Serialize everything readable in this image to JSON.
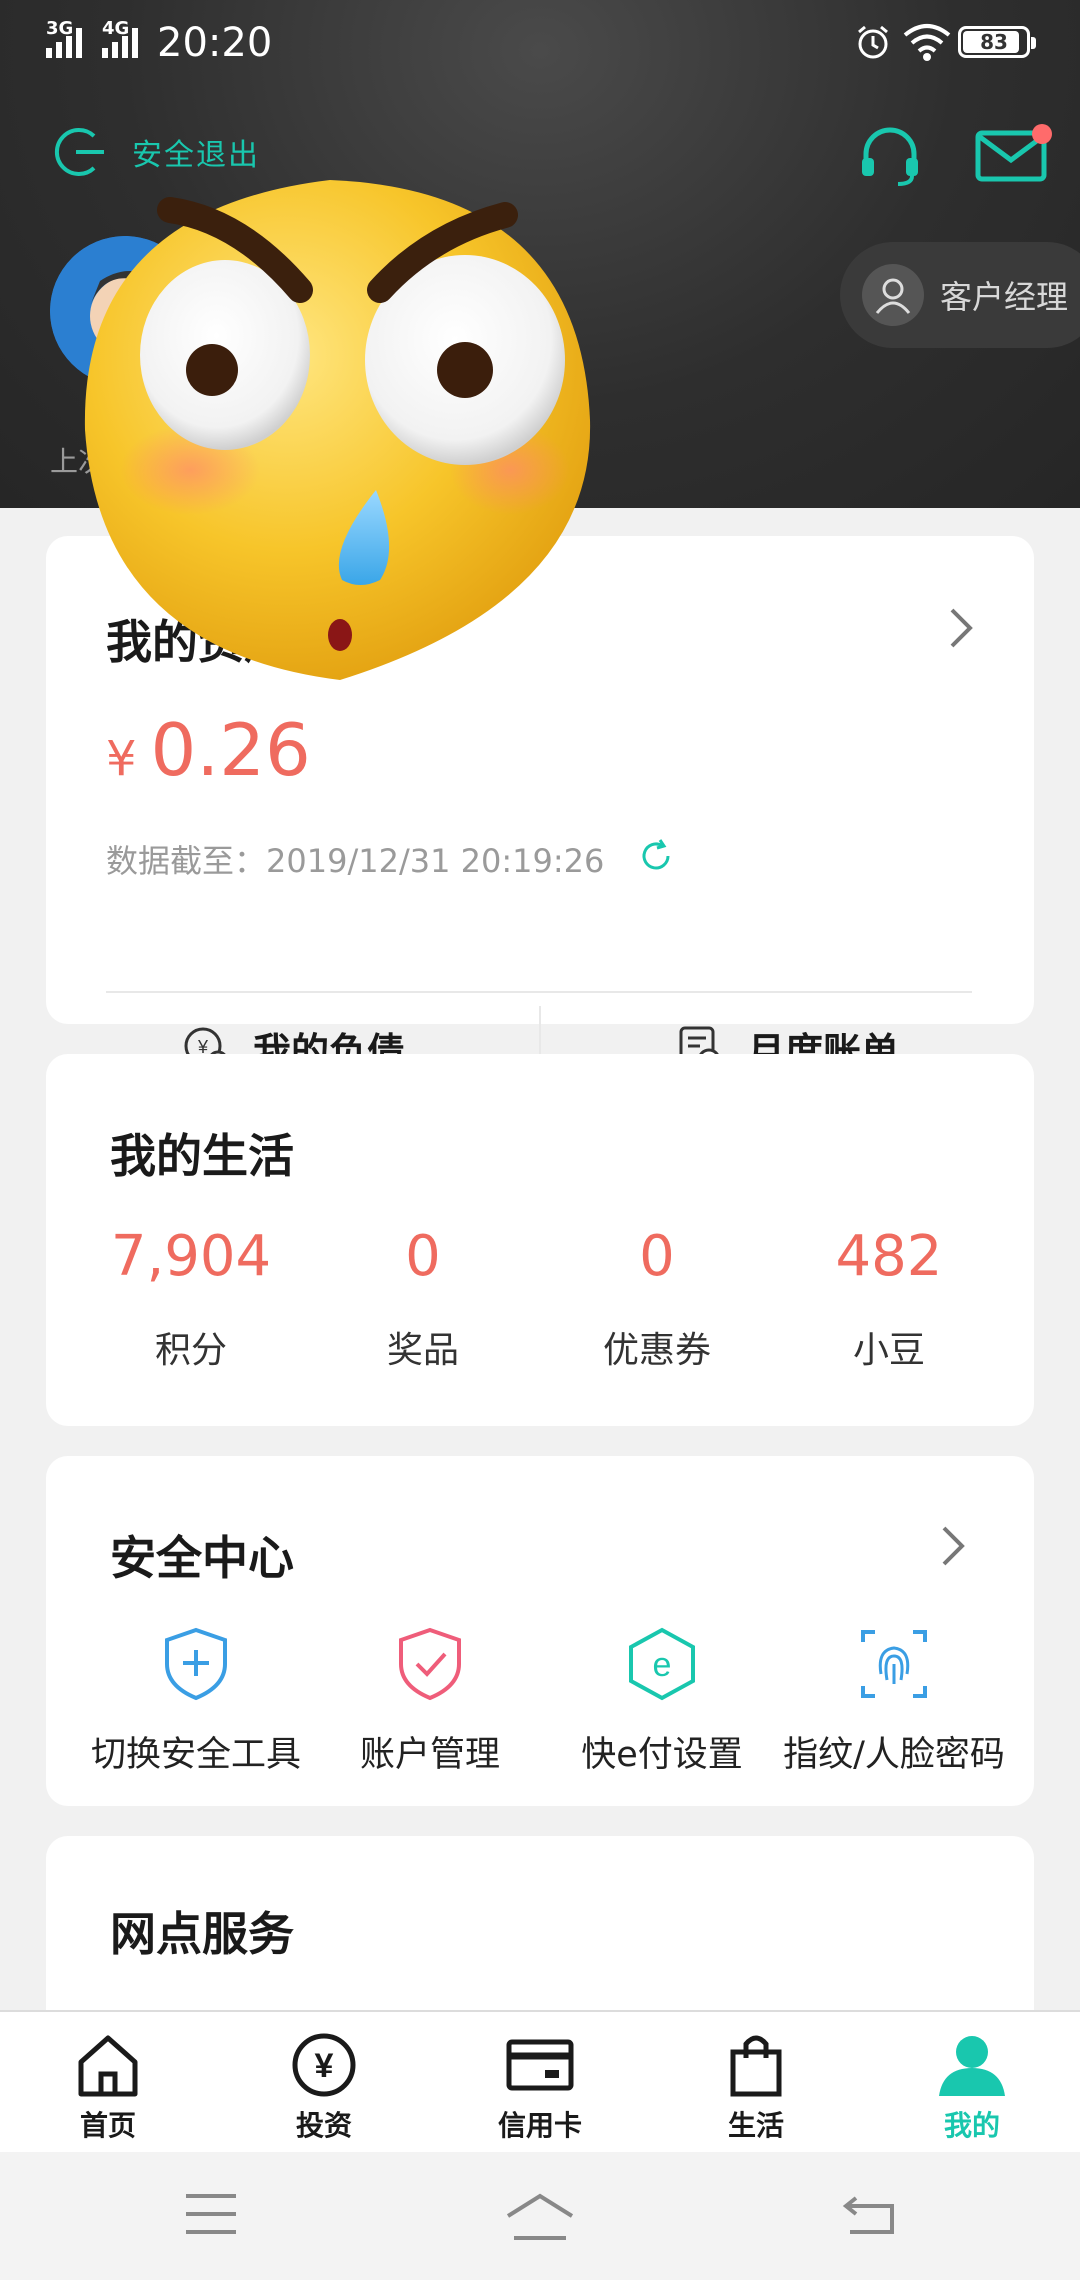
{
  "status_bar": {
    "signal1": "3G",
    "signal2": "4G",
    "time": "20:20",
    "battery": "83"
  },
  "header": {
    "logout_label": "安全退出",
    "last_login_prefix": "上次",
    "manager_label": "客户经理"
  },
  "balance": {
    "title": "我的资产",
    "currency": "¥",
    "amount": "0.26",
    "date_text": "数据截至：2019/12/31 20:19:26",
    "liability_label": "我的负债",
    "bill_label": "月度账单"
  },
  "life": {
    "title": "我的生活",
    "items": [
      {
        "value": "7,904",
        "label": "积分"
      },
      {
        "value": "0",
        "label": "奖品"
      },
      {
        "value": "0",
        "label": "优惠券"
      },
      {
        "value": "482",
        "label": "小豆"
      }
    ]
  },
  "security": {
    "title": "安全中心",
    "items": [
      {
        "label": "切换安全工具",
        "icon": "shield-plus-icon",
        "color": "#3a9ee4"
      },
      {
        "label": "账户管理",
        "icon": "shield-check-icon",
        "color": "#ef5d7a"
      },
      {
        "label": "快e付设置",
        "icon": "e-hexagon-icon",
        "color": "#19c7ae"
      },
      {
        "label": "指纹/人脸密码",
        "icon": "fingerprint-icon",
        "color": "#3a9ee4"
      }
    ]
  },
  "outlet": {
    "title": "网点服务"
  },
  "bottom_nav": [
    {
      "label": "首页",
      "icon": "home-icon"
    },
    {
      "label": "投资",
      "icon": "yen-coin-icon"
    },
    {
      "label": "信用卡",
      "icon": "credit-card-icon"
    },
    {
      "label": "生活",
      "icon": "shopping-bag-icon"
    },
    {
      "label": "我的",
      "icon": "user-icon",
      "active": true
    }
  ],
  "colors": {
    "accent": "#19c7ae",
    "amount": "#ef6b5f",
    "header_bg": "#2e2e2e"
  }
}
